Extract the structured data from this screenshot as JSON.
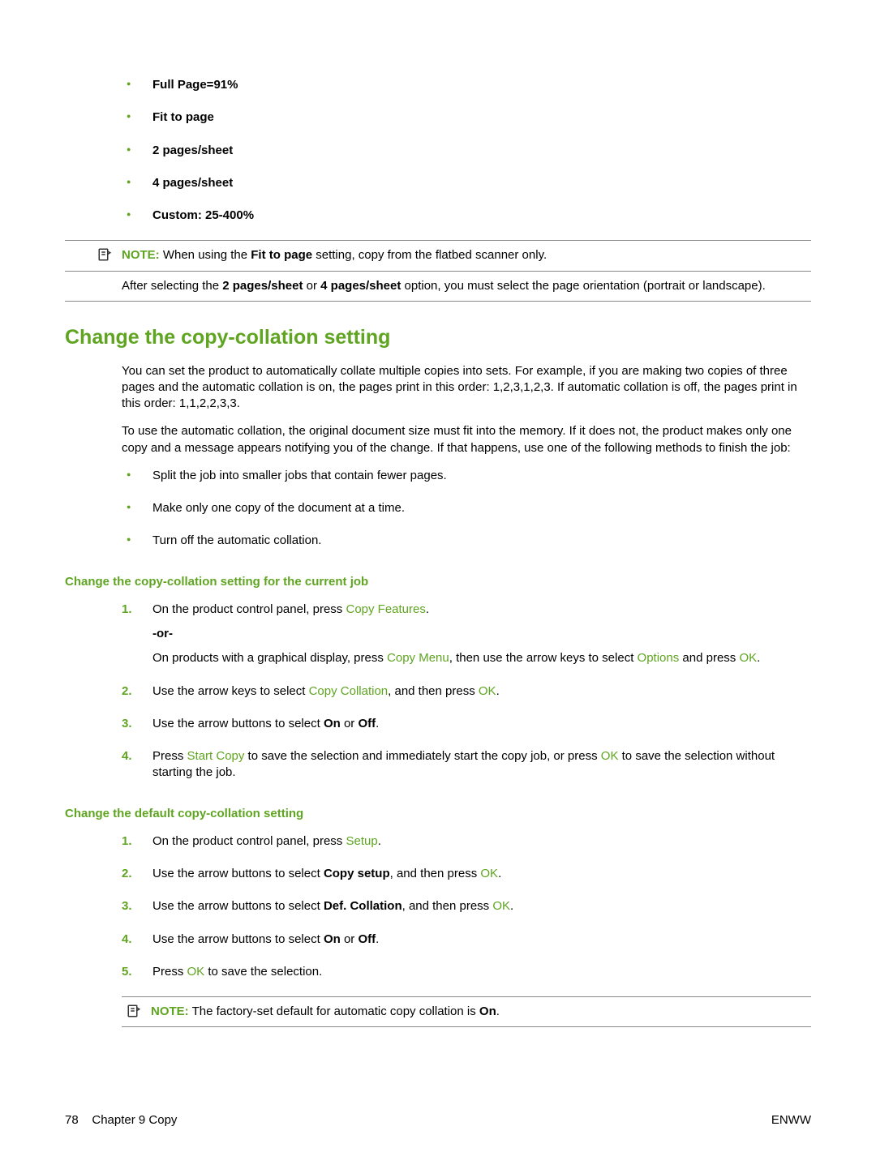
{
  "options": [
    "Full Page=91%",
    "Fit to page",
    "2 pages/sheet",
    "4 pages/sheet",
    "Custom: 25-400%"
  ],
  "note1": {
    "label": "NOTE:",
    "pre": "When using the ",
    "bold": "Fit to page",
    "post": " setting, copy from the flatbed scanner only."
  },
  "afterNote": {
    "pre": "After selecting the ",
    "b1": "2 pages/sheet",
    "mid": " or ",
    "b2": "4 pages/sheet",
    "post": " option, you must select the page orientation (portrait or landscape)."
  },
  "section": {
    "title": "Change the copy-collation setting",
    "para1": "You can set the product to automatically collate multiple copies into sets. For example, if you are making two copies of three pages and the automatic collation is on, the pages print in this order: 1,2,3,1,2,3. If automatic collation is off, the pages print in this order: 1,1,2,2,3,3.",
    "para2": "To use the automatic collation, the original document size must fit into the memory. If it does not, the product makes only one copy and a message appears notifying you of the change. If that happens, use one of the following methods to finish the job:",
    "methods": [
      "Split the job into smaller jobs that contain fewer pages.",
      "Make only one copy of the document at a time.",
      "Turn off the automatic collation."
    ]
  },
  "sub1": {
    "title": "Change the copy-collation setting for the current job",
    "step1": {
      "pre": "On the product control panel, press ",
      "a": "Copy Features",
      "post": "."
    },
    "or": "-or-",
    "step1b": {
      "pre": "On products with a graphical display, press ",
      "a": "Copy Menu",
      "mid": ", then use the arrow keys to select ",
      "b": "Options",
      "mid2": " and press ",
      "c": "OK",
      "post": "."
    },
    "step2": {
      "pre": "Use the arrow keys to select ",
      "a": "Copy Collation",
      "mid": ", and then press ",
      "b": "OK",
      "post": "."
    },
    "step3": {
      "pre": "Use the arrow buttons to select ",
      "b1": "On",
      "mid": " or ",
      "b2": "Off",
      "post": "."
    },
    "step4": {
      "pre": "Press ",
      "a": "Start Copy",
      "mid": " to save the selection and immediately start the copy job, or press ",
      "b": "OK",
      "post": " to save the selection without starting the job."
    }
  },
  "sub2": {
    "title": "Change the default copy-collation setting",
    "step1": {
      "pre": "On the product control panel, press ",
      "a": "Setup",
      "post": "."
    },
    "step2": {
      "pre": "Use the arrow buttons to select ",
      "b": "Copy setup",
      "mid": ", and then press ",
      "a": "OK",
      "post": "."
    },
    "step3": {
      "pre": "Use the arrow buttons to select ",
      "b": "Def. Collation",
      "mid": ", and then press ",
      "a": "OK",
      "post": "."
    },
    "step4": {
      "pre": "Use the arrow buttons to select ",
      "b1": "On",
      "mid": " or ",
      "b2": "Off",
      "post": "."
    },
    "step5": {
      "pre": "Press ",
      "a": "OK",
      "post": " to save the selection."
    }
  },
  "note2": {
    "label": "NOTE:",
    "pre": "The factory-set default for automatic copy collation is ",
    "bold": "On",
    "post": "."
  },
  "footer": {
    "page": "78",
    "chapter": "Chapter 9   Copy",
    "right": "ENWW"
  }
}
